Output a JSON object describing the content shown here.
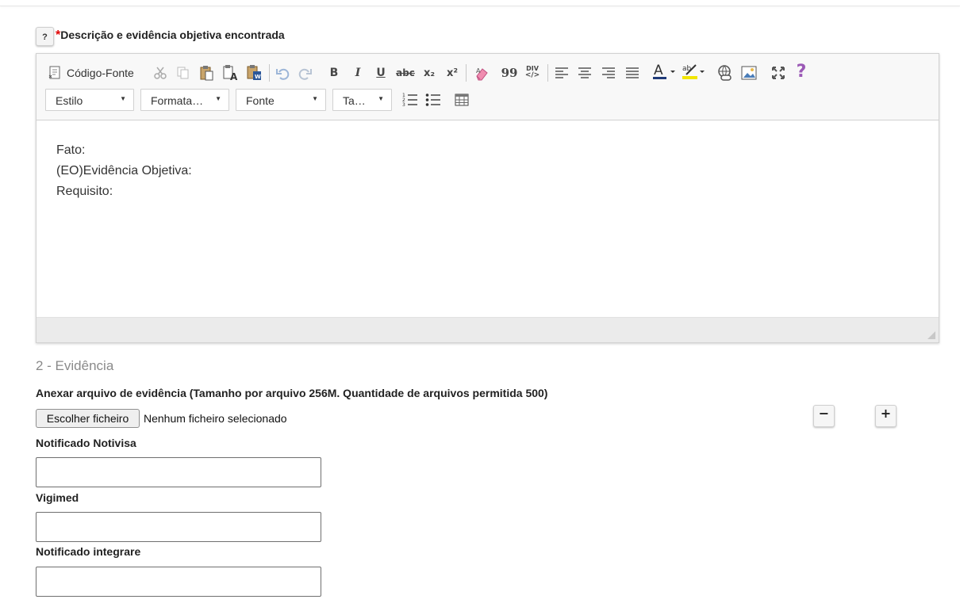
{
  "field": {
    "help_label": "?",
    "required_mark": "*",
    "title": "Descrição e evidência objetiva encontrada"
  },
  "toolbar": {
    "source_label": "Código-Fonte",
    "bold": "B",
    "italic": "I",
    "underline": "U",
    "strike": "abc",
    "subscript": "x₂",
    "superscript": "x²",
    "quote": "99",
    "div": "DIV",
    "combos": {
      "style": "Estilo",
      "format": "Formata…",
      "font": "Fonte",
      "size": "Ta…"
    }
  },
  "editor": {
    "lines": [
      "Fato:",
      "(EO)Evidência Objetiva:",
      "Requisito:"
    ]
  },
  "section": {
    "title": "2 - Evidência"
  },
  "attachment": {
    "label": "Anexar arquivo de evidência (Tamanho por arquivo 256M. Quantidade de arquivos permitida 500)",
    "button_label": "Escolher ficheiro",
    "status": "Nenhum ficheiro selecionado",
    "remove_label": "−",
    "add_label": "+"
  },
  "fields": [
    {
      "label": "Notificado Notivisa",
      "value": ""
    },
    {
      "label": "Vigimed",
      "value": ""
    },
    {
      "label": "Notificado integrare",
      "value": ""
    }
  ],
  "colors": {
    "required": "#e00000",
    "help_icon": "#9b59b6",
    "highlight": "#f2e600",
    "font_color_bar": "#1f3a78"
  }
}
